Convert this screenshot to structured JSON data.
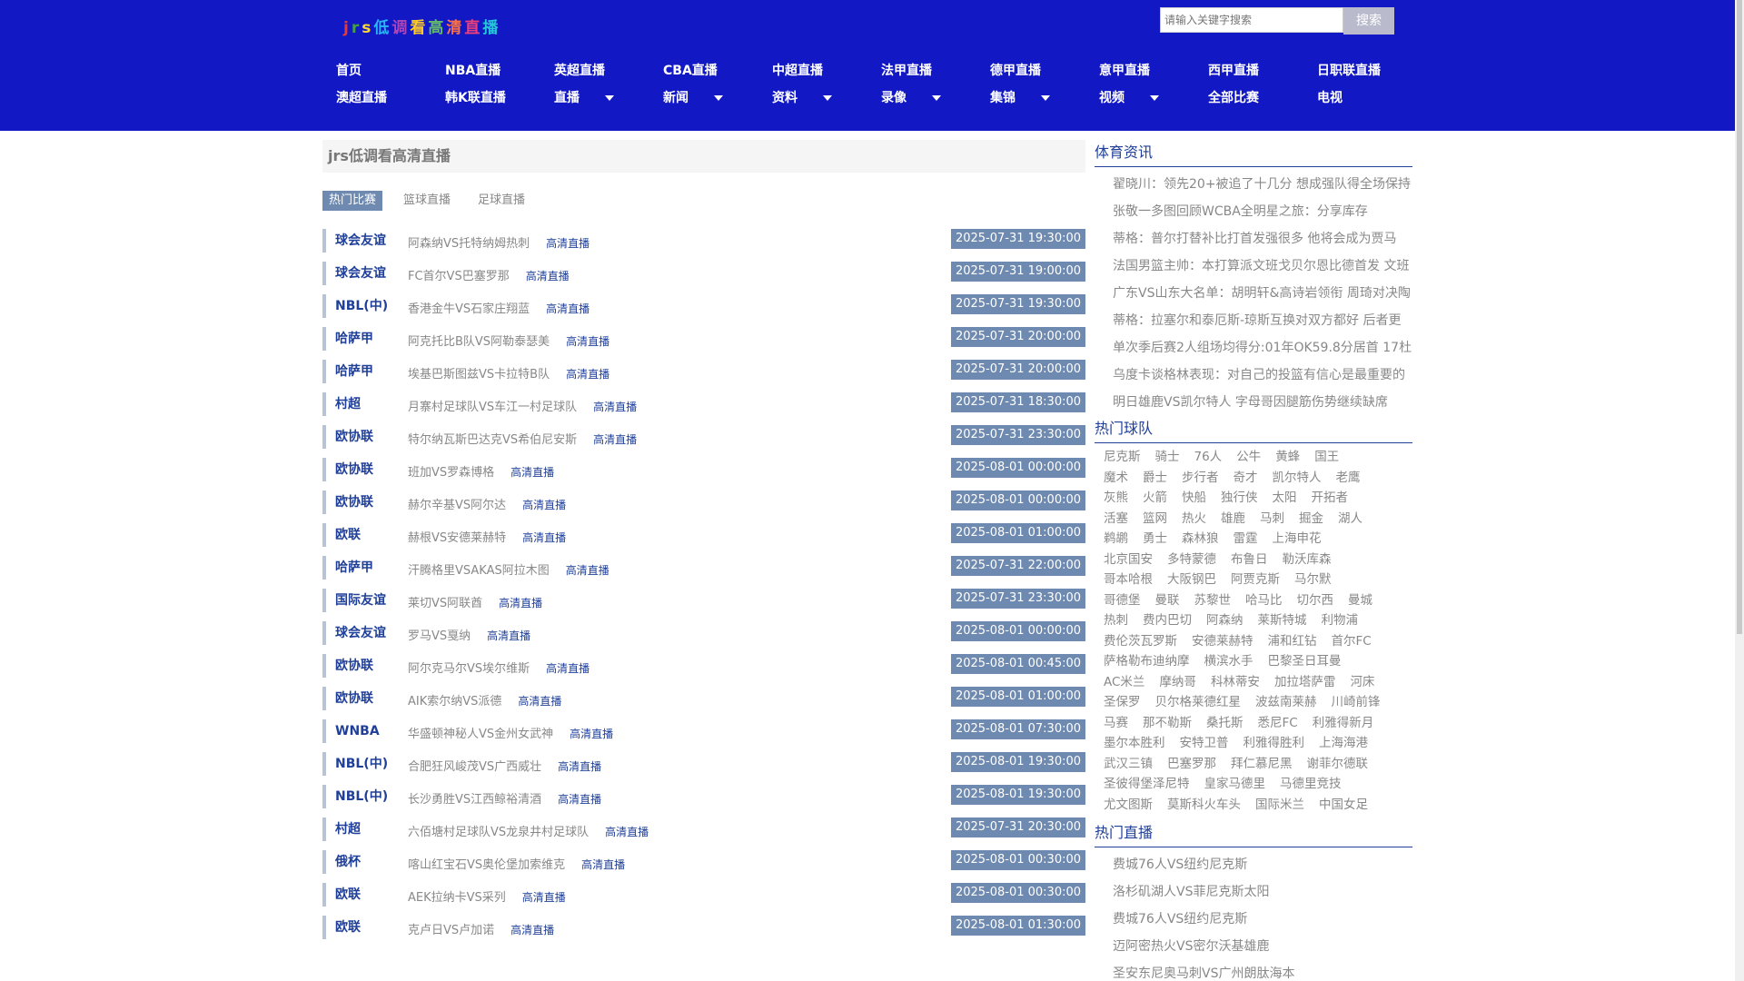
{
  "logo": {
    "chars": [
      {
        "t": "j",
        "c": "#e53935"
      },
      {
        "t": "r",
        "c": "#43a047"
      },
      {
        "t": "s",
        "c": "#fdd835"
      },
      {
        "t": "低",
        "c": "#29b6f6"
      },
      {
        "t": "调",
        "c": "#ab47bc"
      },
      {
        "t": "看",
        "c": "#ffca28"
      },
      {
        "t": "高",
        "c": "#66bb6a"
      },
      {
        "t": "清",
        "c": "#ff7043"
      },
      {
        "t": "直",
        "c": "#ec407a"
      },
      {
        "t": "播",
        "c": "#26c6da"
      }
    ]
  },
  "search": {
    "placeholder": "请输入关键字搜索",
    "button": "搜索"
  },
  "nav_row1": [
    "首页",
    "NBA直播",
    "英超直播",
    "CBA直播",
    "中超直播",
    "法甲直播",
    "德甲直播",
    "意甲直播",
    "西甲直播",
    "日职联直播"
  ],
  "nav_row2": [
    {
      "label": "澳超直播",
      "dropdown": false
    },
    {
      "label": "韩K联直播",
      "dropdown": false
    },
    {
      "label": "直播",
      "dropdown": true
    },
    {
      "label": "新闻",
      "dropdown": true
    },
    {
      "label": "资料",
      "dropdown": true
    },
    {
      "label": "录像",
      "dropdown": true
    },
    {
      "label": "集锦",
      "dropdown": true
    },
    {
      "label": "视频",
      "dropdown": true
    },
    {
      "label": "全部比赛",
      "dropdown": false
    },
    {
      "label": "电视",
      "dropdown": false
    }
  ],
  "main": {
    "title": "jrs低调看高清直播",
    "tabs": [
      "热门比赛",
      "篮球直播",
      "足球直播"
    ],
    "live_label": "高清直播",
    "matches": [
      {
        "league": "球会友谊",
        "teams": "阿森纳VS托特纳姆热刺",
        "time": "2025-07-31 19:30:00"
      },
      {
        "league": "球会友谊",
        "teams": "FC首尔VS巴塞罗那",
        "time": "2025-07-31 19:00:00"
      },
      {
        "league": "NBL(中)",
        "teams": "香港金牛VS石家庄翔蓝",
        "time": "2025-07-31 19:30:00"
      },
      {
        "league": "哈萨甲",
        "teams": "阿克托比B队VS阿勒泰瑟美",
        "time": "2025-07-31 20:00:00"
      },
      {
        "league": "哈萨甲",
        "teams": "埃基巴斯图兹VS卡拉特B队",
        "time": "2025-07-31 20:00:00"
      },
      {
        "league": "村超",
        "teams": "月寨村足球队VS车江一村足球队",
        "time": "2025-07-31 18:30:00"
      },
      {
        "league": "欧协联",
        "teams": "特尔纳瓦斯巴达克VS希伯尼安斯",
        "time": "2025-07-31 23:30:00"
      },
      {
        "league": "欧协联",
        "teams": "班加VS罗森博格",
        "time": "2025-08-01 00:00:00"
      },
      {
        "league": "欧协联",
        "teams": "赫尔辛基VS阿尔达",
        "time": "2025-08-01 00:00:00"
      },
      {
        "league": "欧联",
        "teams": "赫根VS安德莱赫特",
        "time": "2025-08-01 01:00:00"
      },
      {
        "league": "哈萨甲",
        "teams": "汗腾格里VSAKAS阿拉木图",
        "time": "2025-07-31 22:00:00"
      },
      {
        "league": "国际友谊",
        "teams": "莱切VS阿联酋",
        "time": "2025-07-31 23:30:00"
      },
      {
        "league": "球会友谊",
        "teams": "罗马VS戛纳",
        "time": "2025-08-01 00:00:00"
      },
      {
        "league": "欧协联",
        "teams": "阿尔克马尔VS埃尔维斯",
        "time": "2025-08-01 00:45:00"
      },
      {
        "league": "欧协联",
        "teams": "AIK索尔纳VS派德",
        "time": "2025-08-01 01:00:00"
      },
      {
        "league": "WNBA",
        "teams": "华盛顿神秘人VS金州女武神",
        "time": "2025-08-01 07:30:00"
      },
      {
        "league": "NBL(中)",
        "teams": "合肥狂风峻茂VS广西威壮",
        "time": "2025-08-01 19:30:00"
      },
      {
        "league": "NBL(中)",
        "teams": "长沙勇胜VS江西鲸裕清酒",
        "time": "2025-08-01 19:30:00"
      },
      {
        "league": "村超",
        "teams": "六佰塘村足球队VS龙泉井村足球队",
        "time": "2025-07-31 20:30:00"
      },
      {
        "league": "俄杯",
        "teams": "喀山红宝石VS奥伦堡加索维克",
        "time": "2025-08-01 00:30:00"
      },
      {
        "league": "欧联",
        "teams": "AEK拉纳卡VS采列",
        "time": "2025-08-01 00:30:00"
      },
      {
        "league": "欧联",
        "teams": "克卢日VS卢加诺",
        "time": "2025-08-01 01:30:00"
      }
    ]
  },
  "sidebar": {
    "news_title": "体育资讯",
    "news": [
      "翟晓川：领先20+被追了十几分 想成强队得全场保持",
      "张敬一多图回顾WCBA全明星之旅：分享库存",
      "蒂格：普尔打替补比打首发强很多 他将会成为贾马",
      "法国男篮主帅：本打算派文班戈贝尔恩比德首发 文班",
      "广东VS山东大名单：胡明轩&高诗岩领衔 周琦对决陶",
      "蒂格：拉塞尔和泰厄斯-琼斯互换对双方都好 后者更",
      "单次季后赛2人组场均得分:01年OK59.8分居首 17杜",
      "乌度卡谈格林表现：对自己的投篮有信心是最重要的",
      "明日雄鹿VS凯尔特人 字母哥因腿筋伤势继续缺席"
    ],
    "teams_title": "热门球队",
    "team_rows": [
      [
        "尼克斯",
        "骑士",
        "76人",
        "公牛",
        "黄蜂",
        "国王"
      ],
      [
        "魔术",
        "爵士",
        "步行者",
        "奇才",
        "凯尔特人",
        "老鹰"
      ],
      [
        "灰熊",
        "火箭",
        "快船",
        "独行侠",
        "太阳",
        "开拓者"
      ],
      [
        "活塞",
        "篮网",
        "热火",
        "雄鹿",
        "马刺",
        "掘金",
        "湖人"
      ],
      [
        "鹈鹕",
        "勇士",
        "森林狼",
        "雷霆",
        "上海申花"
      ],
      [
        "北京国安",
        "多特蒙德",
        "布鲁日",
        "勒沃库森"
      ],
      [
        "哥本哈根",
        "大阪钢巴",
        "阿贾克斯",
        "马尔默"
      ],
      [
        "哥德堡",
        "曼联",
        "苏黎世",
        "哈马比",
        "切尔西",
        "曼城"
      ],
      [
        "热刺",
        "费内巴切",
        "阿森纳",
        "莱斯特城",
        "利物浦"
      ],
      [
        "费伦茨瓦罗斯",
        "安德莱赫特",
        "浦和红钻",
        "首尔FC"
      ],
      [
        "萨格勒布迪纳摩",
        "横滨水手",
        "巴黎圣日耳曼"
      ],
      [
        "AC米兰",
        "摩纳哥",
        "科林蒂安",
        "加拉塔萨雷",
        "河床"
      ],
      [
        "圣保罗",
        "贝尔格莱德红星",
        "波兹南莱赫",
        "川崎前锋"
      ],
      [
        "马赛",
        "那不勒斯",
        "桑托斯",
        "悉尼FC",
        "利雅得新月"
      ],
      [
        "墨尔本胜利",
        "安特卫普",
        "利雅得胜利",
        "上海海港"
      ],
      [
        "武汉三镇",
        "巴塞罗那",
        "拜仁慕尼黑",
        "谢菲尔德联"
      ],
      [
        "圣彼得堡泽尼特",
        "皇家马德里",
        "马德里竞技"
      ],
      [
        "尤文图斯",
        "莫斯科火车头",
        "国际米兰",
        "中国女足"
      ]
    ],
    "live_title": "热门直播",
    "live": [
      "费城76人VS纽约尼克斯",
      "洛杉矶湖人VS菲尼克斯太阳",
      "费城76人VS纽约尼克斯",
      "迈阿密热火VS密尔沃基雄鹿",
      "圣安东尼奥马刺VS广州朗肽海本"
    ]
  },
  "colors": {
    "header_bg": "#1218c4",
    "accent": "#1f3f99",
    "badge": "#6f8ab0"
  }
}
